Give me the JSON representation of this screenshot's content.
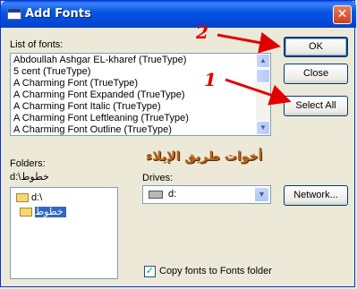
{
  "window": {
    "title": "Add Fonts",
    "close_glyph": "✕"
  },
  "fonts_label": "List of fonts:",
  "fonts": [
    "Abdoullah Ashgar EL-kharef (TrueType)",
    "5 cent (TrueType)",
    "A Charming Font (TrueType)",
    "A Charming Font Expanded (TrueType)",
    "A Charming Font Italic (TrueType)",
    "A Charming Font Leftleaning (TrueType)",
    "A Charming Font Outline (TrueType)"
  ],
  "buttons": {
    "ok": "OK",
    "close": "Close",
    "select_all": "Select All",
    "network": "Network..."
  },
  "folders": {
    "label": "Folders:",
    "current_path": "d:\\خطوط",
    "tree": [
      "d:\\",
      "خطوط"
    ]
  },
  "drives": {
    "label": "Drives:",
    "selected": "d:"
  },
  "copy_fonts": {
    "label": "Copy fonts to Fonts folder",
    "checked": true
  },
  "watermark": "أخوات طريق الإيلاء",
  "annotations": {
    "one": "1",
    "two": "2"
  },
  "icons": [
    "window-icon",
    "close-icon",
    "scroll-up-icon",
    "scroll-down-icon",
    "folder-open-icon",
    "drive-icon",
    "dropdown-arrow-icon",
    "check-icon"
  ],
  "colors": {
    "titlebar": "#0857e4",
    "selection": "#316ac5",
    "annotation": "#e00000"
  }
}
